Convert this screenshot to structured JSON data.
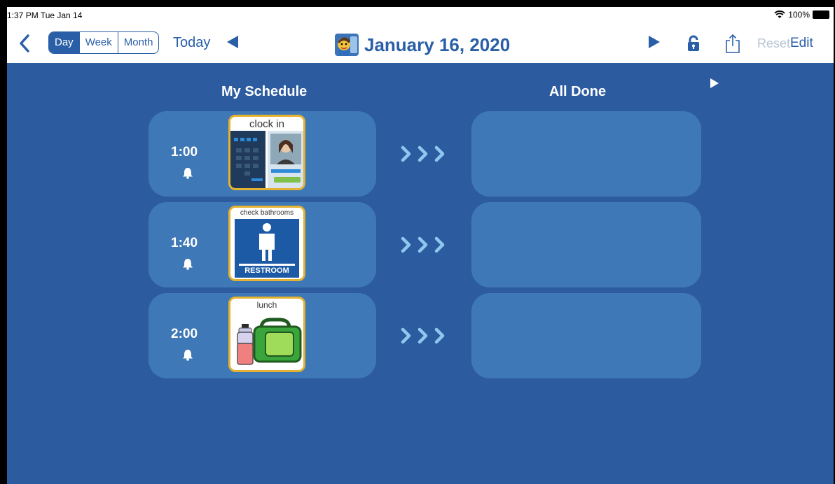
{
  "status_bar": {
    "time": "1:37 PM  Tue Jan 14",
    "battery": "100%"
  },
  "nav": {
    "segments": [
      "Day",
      "Week",
      "Month"
    ],
    "active_segment": "Day",
    "today_label": "Today",
    "title": "January 16, 2020",
    "reset_label": "Reset",
    "edit_label": "Edit"
  },
  "columns": {
    "schedule_title": "My Schedule",
    "done_title": "All Done"
  },
  "schedule": [
    {
      "time": "1:00",
      "activity": "clock in"
    },
    {
      "time": "1:40",
      "activity": "check bathrooms",
      "sign_text": "RESTROOM"
    },
    {
      "time": "2:00",
      "activity": "lunch"
    }
  ],
  "colors": {
    "accent": "#2a5fa8",
    "background": "#2d5ba0",
    "card": "#3f78b6",
    "picto_border": "#e3b230"
  }
}
